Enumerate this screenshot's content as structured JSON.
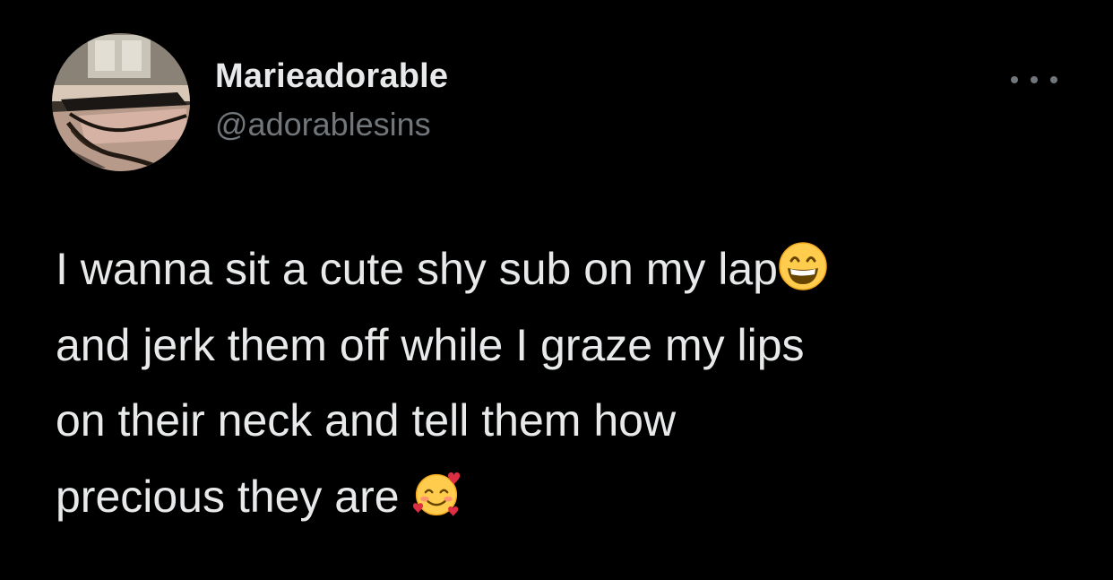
{
  "author": {
    "display_name": "Marieadorable",
    "handle": "@adorablesins",
    "avatar_icon": "profile-photo"
  },
  "tweet": {
    "lines": [
      "I wanna sit a cute shy sub on my lap",
      "and jerk them off while I graze my lips",
      "on their neck and tell them how",
      "precious they are "
    ],
    "emojis": [
      "grinning-face-with-smiling-eyes",
      "smiling-face-with-hearts"
    ]
  },
  "actions": {
    "more_icon": "more-options"
  },
  "colors": {
    "background": "#000000",
    "primary_text": "#e7e9ea",
    "secondary_text": "#71767b"
  }
}
